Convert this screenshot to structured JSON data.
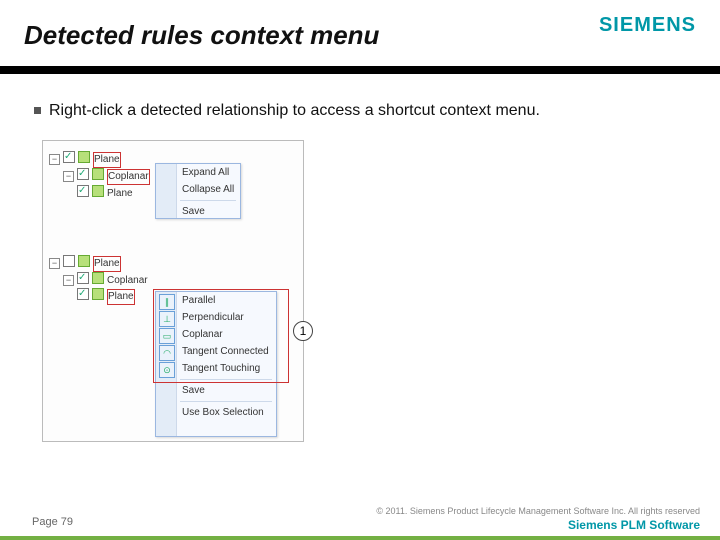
{
  "header": {
    "title": "Detected rules context menu",
    "logo": "SIEMENS"
  },
  "bullet": "Right-click a detected relationship to access a shortcut context menu.",
  "tree": {
    "g1": {
      "root": "Plane",
      "child1": "Coplanar",
      "child2": "Plane"
    },
    "g2": {
      "root": "Plane",
      "child1": "Coplanar",
      "child2": "Plane"
    }
  },
  "menu1": {
    "items": [
      "Expand All",
      "Collapse All",
      "Save"
    ]
  },
  "menu2": {
    "items": [
      "Parallel",
      "Perpendicular",
      "Coplanar",
      "Tangent Connected",
      "Tangent Touching"
    ],
    "tail": [
      "Save",
      "Use Box Selection"
    ]
  },
  "callout": "1",
  "footer": {
    "copyright": "© 2011. Siemens Product Lifecycle Management Software Inc. All rights reserved",
    "brand": "Siemens PLM Software",
    "page": "Page 79"
  }
}
